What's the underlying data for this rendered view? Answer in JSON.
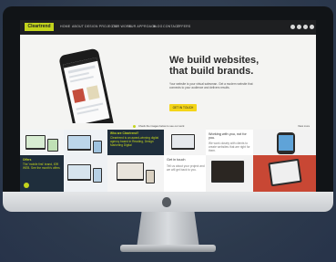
{
  "nav": {
    "logo": "Cleartrend",
    "items": [
      "HOME",
      "ABOUT",
      "DESIGN PROJECTS",
      "OUR WORK",
      "OUR APPROACH",
      "BLOG",
      "CONTACT",
      "OFFERS"
    ]
  },
  "hero": {
    "headline_line1": "We build websites,",
    "headline_line2": "that build brands.",
    "subtext": "Your website is your virtual salesman. Get a modern website that connects to your audience and delivers results.",
    "cta_label": "GET IN TOUCH"
  },
  "strip": {
    "text": "Check the images below to see our work",
    "right": "View more"
  },
  "tiles": {
    "who_title": "Who are Cleartrend?",
    "who_body": "Cleartrend is an award-winning digital agency based in Reading, Design Marketing Digital",
    "working_title": "Working with you, not for you.",
    "working_body": "We work closely with clients to create websites that are right for them.",
    "offers_title": "Offers",
    "offers_body": "The 'mobile first' brand, £99 WEB. See the month's offers",
    "touch_title": "Get in touch",
    "touch_body": "Tell us about your project and we will get back to you."
  },
  "colors": {
    "accent": "#c3d41c",
    "dark": "#1f2e3c",
    "cta": "#f4d518"
  }
}
